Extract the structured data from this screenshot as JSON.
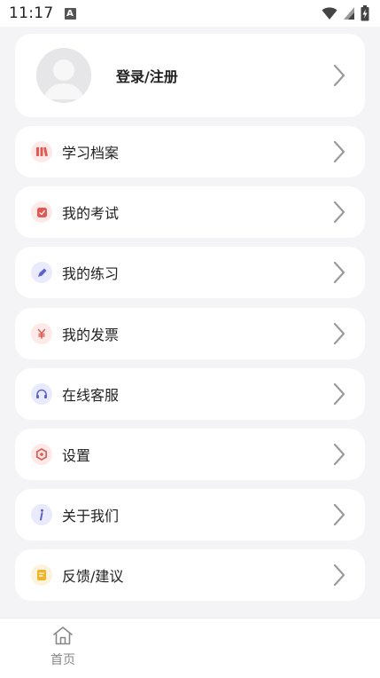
{
  "status_bar": {
    "time": "11:17",
    "notification_badge": "A"
  },
  "profile": {
    "login_label": "登录/注册"
  },
  "menu": [
    {
      "label": "学习档案",
      "icon": "archive-icon",
      "color": "#e05a55",
      "bg": "#fde9e8"
    },
    {
      "label": "我的考试",
      "icon": "exam-icon",
      "color": "#e05a55",
      "bg": "#fde9e8"
    },
    {
      "label": "我的练习",
      "icon": "pen-icon",
      "color": "#5b62c9",
      "bg": "#e9eafc"
    },
    {
      "label": "我的发票",
      "icon": "yen-icon",
      "color": "#e05a55",
      "bg": "#fde9e8"
    },
    {
      "label": "在线客服",
      "icon": "headset-icon",
      "color": "#5b62c9",
      "bg": "#e9eafc"
    },
    {
      "label": "设置",
      "icon": "hexagon-settings-icon",
      "color": "#e05a55",
      "bg": "#fde9e8"
    },
    {
      "label": "关于我们",
      "icon": "info-icon",
      "color": "#5b62c9",
      "bg": "#e9eafc"
    },
    {
      "label": "反馈/建议",
      "icon": "feedback-icon",
      "color": "#f0b429",
      "bg": "#fdf3dc"
    }
  ],
  "tab_bar": {
    "home_label": "首页"
  }
}
